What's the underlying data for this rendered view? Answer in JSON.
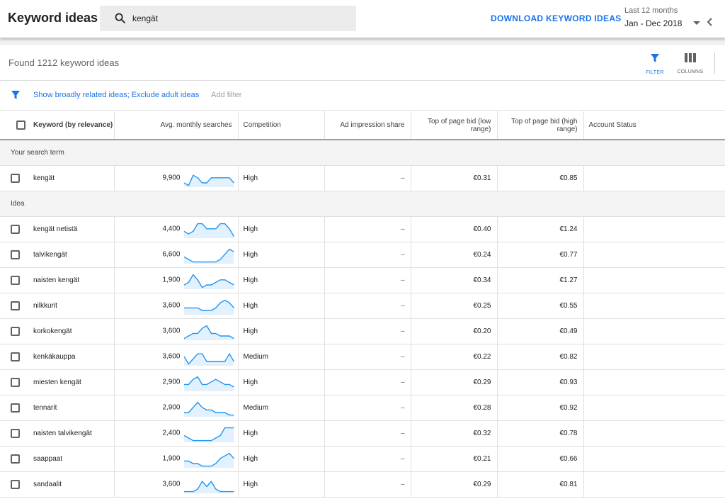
{
  "header": {
    "title": "Keyword ideas",
    "search_value": "kengät",
    "download_label": "DOWNLOAD KEYWORD IDEAS",
    "range_label": "Last 12 months",
    "range_value": "Jan - Dec 2018"
  },
  "toolbar": {
    "found_text": "Found 1212 keyword ideas",
    "filter_label": "FILTER",
    "columns_label": "COLUMNS"
  },
  "filter_bar": {
    "active_filters": "Show broadly related ideas; Exclude adult ideas",
    "add_filter_label": "Add filter"
  },
  "columns": {
    "keyword": "Keyword (by relevance)",
    "avg_searches": "Avg. monthly searches",
    "competition": "Competition",
    "ad_impression": "Ad impression share",
    "bid_low": "Top of page bid (low range)",
    "bid_high": "Top of page bid (high range)",
    "account_status": "Account Status"
  },
  "sections": [
    {
      "title": "Your search term",
      "rows": [
        {
          "keyword": "kengät",
          "avg": "9,900",
          "competition": "High",
          "impression": "–",
          "low": "€0.31",
          "high": "€0.85",
          "trend": [
            5,
            6,
            2,
            3,
            5,
            5,
            3,
            3,
            3,
            3,
            3,
            5
          ]
        }
      ]
    },
    {
      "title": "Idea",
      "rows": [
        {
          "keyword": "kengät netistä",
          "avg": "4,400",
          "competition": "High",
          "impression": "–",
          "low": "€0.40",
          "high": "€1.24",
          "trend": [
            4,
            5,
            4,
            1,
            1,
            3,
            3,
            3,
            1,
            1,
            3,
            6
          ]
        },
        {
          "keyword": "talvikengät",
          "avg": "6,600",
          "competition": "High",
          "impression": "–",
          "low": "€0.24",
          "high": "€0.77",
          "trend": [
            4,
            5,
            6,
            6,
            6,
            6,
            6,
            6,
            5,
            3,
            1,
            2
          ]
        },
        {
          "keyword": "naisten kengät",
          "avg": "1,900",
          "competition": "High",
          "impression": "–",
          "low": "€0.34",
          "high": "€1.27",
          "trend": [
            5,
            4,
            1,
            3,
            6,
            5,
            5,
            4,
            3,
            3,
            4,
            5
          ]
        },
        {
          "keyword": "nilkkurit",
          "avg": "3,600",
          "competition": "High",
          "impression": "–",
          "low": "€0.25",
          "high": "€0.55",
          "trend": [
            4,
            4,
            4,
            4,
            5,
            5,
            5,
            4,
            2,
            1,
            2,
            4
          ]
        },
        {
          "keyword": "korkokengät",
          "avg": "3,600",
          "competition": "High",
          "impression": "–",
          "low": "€0.20",
          "high": "€0.49",
          "trend": [
            6,
            5,
            4,
            4,
            2,
            1,
            4,
            4,
            5,
            5,
            5,
            6
          ]
        },
        {
          "keyword": "kenkäkauppa",
          "avg": "3,600",
          "competition": "Medium",
          "impression": "–",
          "low": "€0.22",
          "high": "€0.82",
          "trend": [
            3,
            6,
            4,
            2,
            2,
            5,
            5,
            5,
            5,
            5,
            2,
            5
          ]
        },
        {
          "keyword": "miesten kengät",
          "avg": "2,900",
          "competition": "High",
          "impression": "–",
          "low": "€0.29",
          "high": "€0.93",
          "trend": [
            4,
            4,
            2,
            1,
            4,
            4,
            3,
            2,
            3,
            4,
            4,
            5
          ]
        },
        {
          "keyword": "tennarit",
          "avg": "2,900",
          "competition": "Medium",
          "impression": "–",
          "low": "€0.28",
          "high": "€0.92",
          "trend": [
            5,
            5,
            3,
            1,
            3,
            4,
            4,
            5,
            5,
            5,
            6,
            6
          ]
        },
        {
          "keyword": "naisten talvikengät",
          "avg": "2,400",
          "competition": "High",
          "impression": "–",
          "low": "€0.32",
          "high": "€0.78",
          "trend": [
            4,
            5,
            6,
            6,
            6,
            6,
            6,
            5,
            4,
            1,
            1,
            1
          ]
        },
        {
          "keyword": "saappaat",
          "avg": "1,900",
          "competition": "High",
          "impression": "–",
          "low": "€0.21",
          "high": "€0.66",
          "trend": [
            4,
            4,
            5,
            5,
            6,
            6,
            6,
            5,
            3,
            2,
            1,
            3
          ]
        },
        {
          "keyword": "sandaalit",
          "avg": "3,600",
          "competition": "High",
          "impression": "–",
          "low": "€0.29",
          "high": "€0.81",
          "trend": [
            6,
            6,
            6,
            5,
            2,
            4,
            2,
            5,
            6,
            6,
            6,
            6
          ]
        }
      ]
    }
  ],
  "colors": {
    "accent": "#1a73e8",
    "spark_line": "#2196f3",
    "spark_fill": "#e3f0fd"
  }
}
